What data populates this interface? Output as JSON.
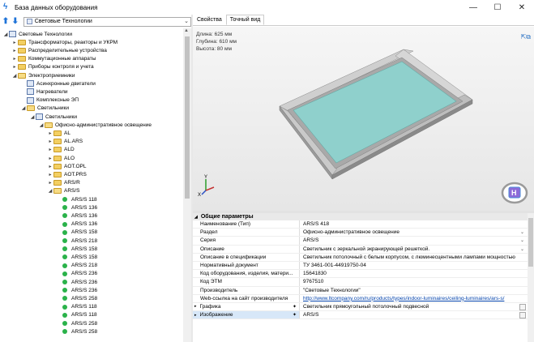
{
  "window": {
    "title": "База данных оборудования",
    "controls": {
      "minimize": "—",
      "maximize": "☐",
      "close": "✕"
    }
  },
  "toolbar": {
    "back_icon": "arrow-up-icon",
    "forward_icon": "arrow-down-icon",
    "source_selected": "Световые Технологии"
  },
  "tree": {
    "nodes": [
      {
        "label": "Световые Технологии",
        "level": 0,
        "icon": "db",
        "expand": "◢"
      },
      {
        "label": "Трансформаторы, реакторы и УКРМ",
        "level": 1,
        "icon": "folder",
        "expand": "▸"
      },
      {
        "label": "Распределительные устройства",
        "level": 1,
        "icon": "folder",
        "expand": "▸"
      },
      {
        "label": "Коммутационные аппараты",
        "level": 1,
        "icon": "folder",
        "expand": "▸"
      },
      {
        "label": "Приборы контроля и учета",
        "level": 1,
        "icon": "folder",
        "expand": "▸"
      },
      {
        "label": "Электроприемники",
        "level": 1,
        "icon": "folder-open",
        "expand": "◢"
      },
      {
        "label": "Асинхронные двигатели",
        "level": 2,
        "icon": "db",
        "expand": ""
      },
      {
        "label": "Нагреватели",
        "level": 2,
        "icon": "db",
        "expand": ""
      },
      {
        "label": "Комплексные ЭП",
        "level": 2,
        "icon": "db",
        "expand": ""
      },
      {
        "label": "Светильники",
        "level": 2,
        "icon": "folder-open",
        "expand": "◢"
      },
      {
        "label": "Светильники",
        "level": 3,
        "icon": "db",
        "expand": "◢"
      },
      {
        "label": "Офисно-административное освещение",
        "level": 4,
        "icon": "folder-open",
        "expand": "◢"
      },
      {
        "label": "AL",
        "level": 5,
        "icon": "folder",
        "expand": "▸"
      },
      {
        "label": "AL.ARS",
        "level": 5,
        "icon": "folder",
        "expand": "▸"
      },
      {
        "label": "ALD",
        "level": 5,
        "icon": "folder",
        "expand": "▸"
      },
      {
        "label": "ALO",
        "level": 5,
        "icon": "folder",
        "expand": "▸"
      },
      {
        "label": "AOT.OPL",
        "level": 5,
        "icon": "folder",
        "expand": "▸"
      },
      {
        "label": "AOT.PRS",
        "level": 5,
        "icon": "folder",
        "expand": "▸"
      },
      {
        "label": "ARS/R",
        "level": 5,
        "icon": "folder",
        "expand": "▸"
      },
      {
        "label": "ARS/S",
        "level": 5,
        "icon": "folder-open",
        "expand": "◢"
      },
      {
        "label": "ARS/S 118",
        "level": 6,
        "icon": "dot",
        "expand": ""
      },
      {
        "label": "ARS/S 136",
        "level": 6,
        "icon": "dot",
        "expand": ""
      },
      {
        "label": "ARS/S 136",
        "level": 6,
        "icon": "dot",
        "expand": ""
      },
      {
        "label": "ARS/S 136",
        "level": 6,
        "icon": "dot",
        "expand": ""
      },
      {
        "label": "ARS/S 158",
        "level": 6,
        "icon": "dot",
        "expand": ""
      },
      {
        "label": "ARS/S 218",
        "level": 6,
        "icon": "dot",
        "expand": ""
      },
      {
        "label": "ARS/S 158",
        "level": 6,
        "icon": "dot",
        "expand": ""
      },
      {
        "label": "ARS/S 158",
        "level": 6,
        "icon": "dot",
        "expand": ""
      },
      {
        "label": "ARS/S 218",
        "level": 6,
        "icon": "dot",
        "expand": ""
      },
      {
        "label": "ARS/S 236",
        "level": 6,
        "icon": "dot",
        "expand": ""
      },
      {
        "label": "ARS/S 236",
        "level": 6,
        "icon": "dot",
        "expand": ""
      },
      {
        "label": "ARS/S 236",
        "level": 6,
        "icon": "dot",
        "expand": ""
      },
      {
        "label": "ARS/S 258",
        "level": 6,
        "icon": "dot",
        "expand": ""
      },
      {
        "label": "ARS/S 118",
        "level": 6,
        "icon": "dot",
        "expand": ""
      },
      {
        "label": "ARS/S 118",
        "level": 6,
        "icon": "dot",
        "expand": ""
      },
      {
        "label": "ARS/S 258",
        "level": 6,
        "icon": "dot",
        "expand": ""
      },
      {
        "label": "ARS/S 258",
        "level": 6,
        "icon": "dot",
        "expand": ""
      }
    ]
  },
  "tabs": [
    {
      "label": "Свойства",
      "active": false
    },
    {
      "label": "Точный вид",
      "active": true
    }
  ],
  "viewport": {
    "width_label": "Длина: 625 мм",
    "depth_label": "Глубина: 610 мм",
    "height_label": "Высота: 80 мм",
    "axis_y": "Y",
    "axis_x": "X",
    "viewcube_icon": "view-cube-icon",
    "panel_color": "#8fd0cc",
    "frame_color": "#b7b7b7"
  },
  "properties": {
    "category": "Общие параметры",
    "rows": [
      {
        "name": "Наименование (Тип)",
        "value": "ARS/S 418",
        "control": ""
      },
      {
        "name": "Раздел",
        "value": "Офисно-административное освещение",
        "control": "dropdown"
      },
      {
        "name": "Серия",
        "value": "ARS/S",
        "control": "dropdown"
      },
      {
        "name": "Описание",
        "value": "Светильник с зеркальной экранирующей решеткой.",
        "control": "dropdown"
      },
      {
        "name": "Описание в спецификации",
        "value": "Светильник потолочный с белым корпусом, с люминесцентными лампами мощностью",
        "control": ""
      },
      {
        "name": "Нормативный документ",
        "value": "ТУ 3461-001-44919750-04",
        "control": ""
      },
      {
        "name": "Код оборудования, изделия, матери...",
        "value": "15641830",
        "control": ""
      },
      {
        "name": "Код ЭТМ",
        "value": "9767510",
        "control": ""
      },
      {
        "name": "Производитель",
        "value": "\"Световые Технологии\"",
        "control": ""
      },
      {
        "name": "Web-ссылка на сайт производителя",
        "value": "http://www.ltcompany.com/ru/products/types/indoor-luminaires/ceiling-luminaires/ars-s/",
        "control": "link"
      },
      {
        "name": "Графика",
        "value": "Светильник прямоугольный потолочный подвесной",
        "control": "ellipsis",
        "sub": true
      },
      {
        "name": "Изображение",
        "value": "ARS/S",
        "control": "ellipsis",
        "sub": true,
        "highlight": true
      }
    ]
  }
}
